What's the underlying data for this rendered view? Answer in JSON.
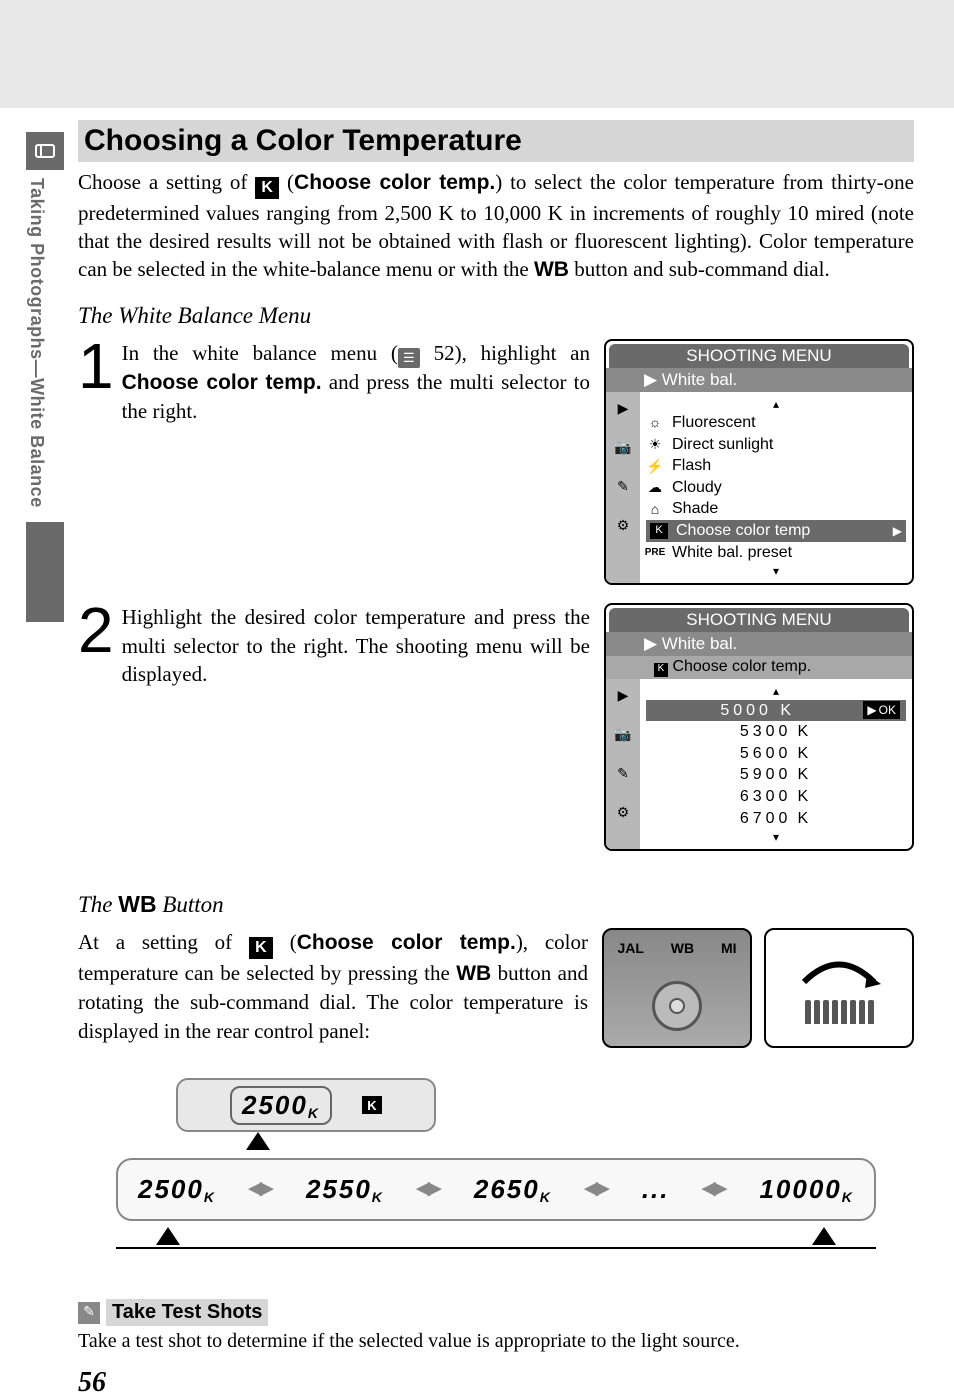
{
  "sidebar": {
    "label": "Taking Photographs—White Balance"
  },
  "heading": "Choosing a Color Temperature",
  "intro": {
    "p1a": "Choose a setting of ",
    "p1b": " (",
    "p1c": "Choose color temp.",
    "p1d": ") to select the color temperature from thirty-one predetermined values ranging from 2,500 K to 10,000 K in increments of roughly 10 mired (note that the desired results will not be obtained with flash or fluorescent lighting).  Color temperature can be selected in the white-balance menu or with the ",
    "p1e": "WB",
    "p1f": " button and sub-command dial."
  },
  "subhead1": "The White Balance Menu",
  "step1": {
    "num": "1",
    "a": "In the white balance menu (",
    "ref": " 52), highlight an ",
    "bold": "Choose color temp.",
    "c": " and press the multi selector to the right."
  },
  "step2": {
    "num": "2",
    "text": "Highlight the desired color temperature and press the multi selector to the right.  The shooting menu will be displayed."
  },
  "menu1": {
    "title": "SHOOTING MENU",
    "sub": "White bal.",
    "items": [
      "Fluorescent",
      "Direct sunlight",
      "Flash",
      "Cloudy",
      "Shade",
      "Choose color temp",
      "White bal. preset"
    ],
    "pre": "PRE"
  },
  "menu2": {
    "title": "SHOOTING MENU",
    "sub": "White bal.",
    "sub2": "Choose color temp.",
    "values": [
      "5000",
      "5300",
      "5600",
      "5900",
      "6300",
      "6700"
    ],
    "unit": "K",
    "ok": "OK"
  },
  "wb": {
    "head_a": "The ",
    "head_b": "WB",
    "head_c": " Button",
    "a": "At a setting of ",
    "b": " (",
    "c": "Choose color temp.",
    "d": "), color temperature can be selected by pressing the ",
    "e": "WB",
    "f": " button and rotating the sub-command dial.  The color temperature is displayed in the rear control panel:"
  },
  "cam": {
    "l1": "JAL",
    "l2": "WB",
    "l3": "MI"
  },
  "lcd": {
    "top": "2500",
    "top_suffix": "K",
    "seq": [
      "2500",
      "2550",
      "2650",
      "...",
      "10000"
    ],
    "suffix": "K"
  },
  "note": {
    "title": "Take Test Shots",
    "text": "Take a test shot to determine if the selected value is appropriate to the light source."
  },
  "page": "56",
  "k_letter": "K"
}
